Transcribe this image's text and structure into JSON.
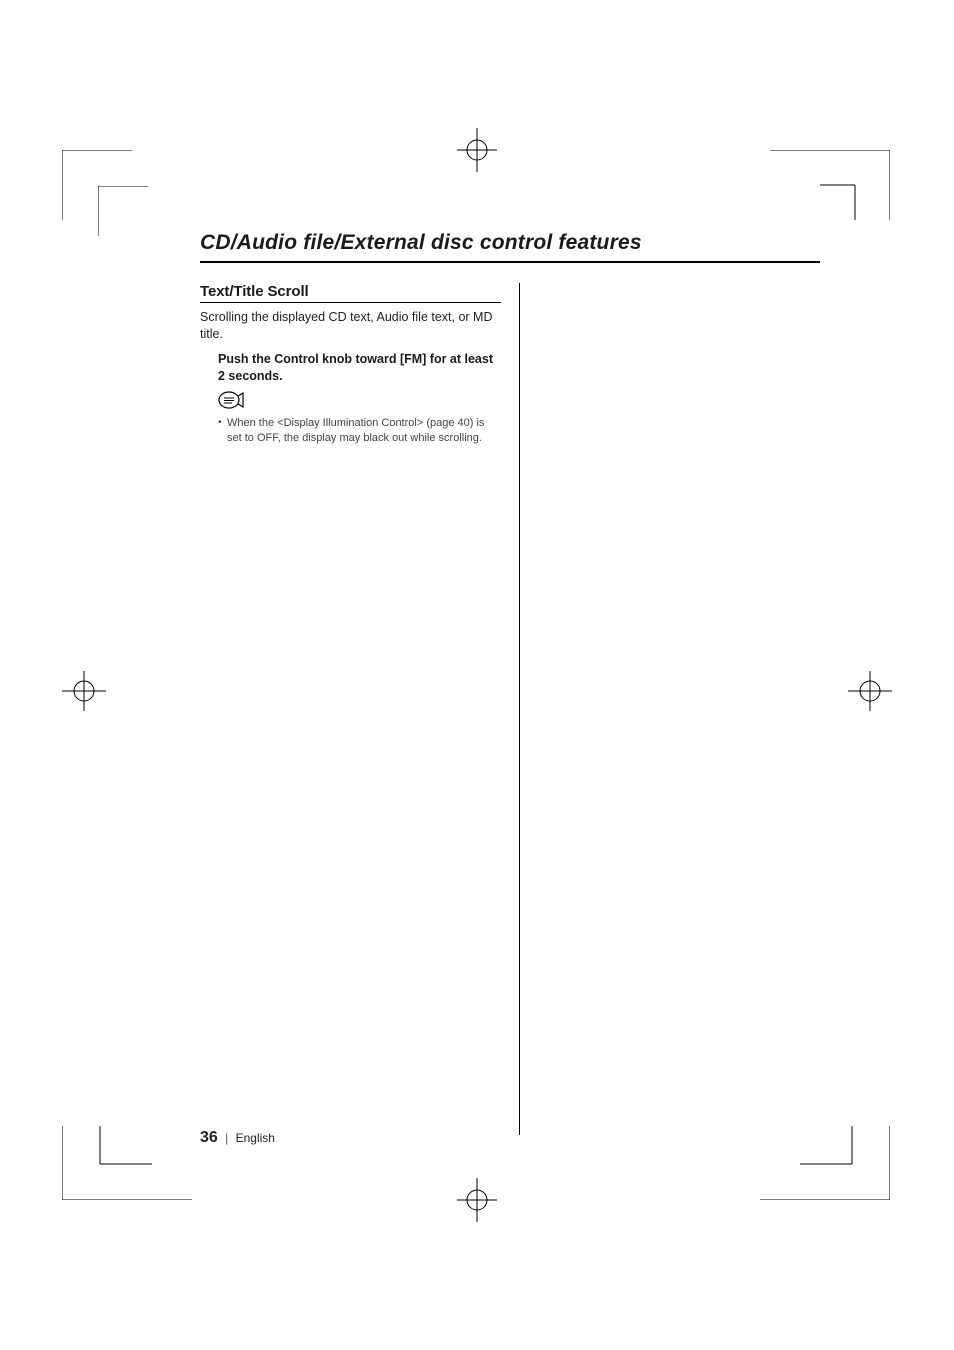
{
  "chapter_title": "CD/Audio file/External disc control features",
  "section": {
    "title": "Text/Title Scroll",
    "intro": "Scrolling the displayed CD text, Audio file text, or MD title.",
    "instruction": "Push the Control knob toward [FM] for at least 2 seconds.",
    "note": "When the <Display Illumination Control> (page 40) is set to OFF, the display may black out while scrolling."
  },
  "footer": {
    "page_number": "36",
    "language": "English"
  }
}
